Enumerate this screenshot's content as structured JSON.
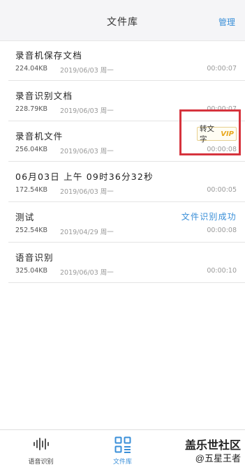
{
  "header": {
    "title": "文件库",
    "manage": "管理"
  },
  "files": [
    {
      "name": "录音机保存文档",
      "size": "224.04KB",
      "date": "2019/06/03 周一",
      "duration": "00:00:07"
    },
    {
      "name": "录音识别文档",
      "size": "228.79KB",
      "date": "2019/06/03 周一",
      "duration": "00:00:07"
    },
    {
      "name": "录音机文件",
      "size": "256.04KB",
      "date": "2019/06/03 周一",
      "duration": "00:00:08",
      "badge": {
        "text": "转文字",
        "vip": "VIP"
      }
    },
    {
      "name": "06月03日 上午 09时36分32秒",
      "size": "172.54KB",
      "date": "2019/06/03 周一",
      "duration": "00:00:05"
    },
    {
      "name": "测试",
      "size": "252.54KB",
      "date": "2019/04/29 周一",
      "duration": "00:00:08",
      "status": "文件识别成功"
    },
    {
      "name": "语音识别",
      "size": "325.04KB",
      "date": "2019/06/03 周一",
      "duration": "00:00:10"
    }
  ],
  "tabs": [
    {
      "label": "语音识别",
      "icon": "waveform-icon",
      "active": false
    },
    {
      "label": "文件库",
      "icon": "file-library-icon",
      "active": true
    }
  ],
  "watermark": {
    "line1": "盖乐世社区",
    "line2": "@五星王者"
  },
  "colors": {
    "accent": "#3a8fd8",
    "highlight_box": "#d6333d",
    "vip_gold": "#e8a81e"
  }
}
